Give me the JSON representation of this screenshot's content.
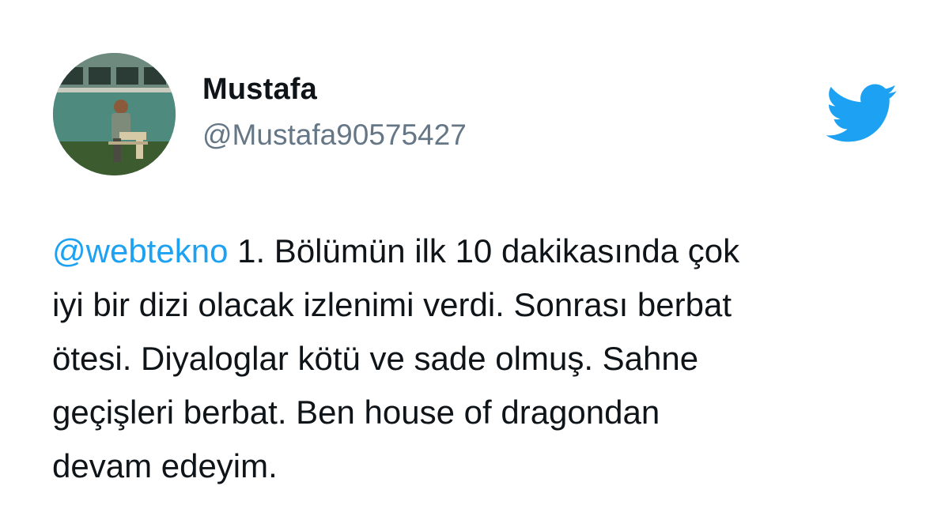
{
  "user": {
    "display_name": "Mustafa",
    "handle": "@Mustafa90575427",
    "avatar_icon": "profile-photo"
  },
  "logo": {
    "icon": "twitter-bird-icon",
    "color": "#1DA1F2"
  },
  "tweet": {
    "mention": "@webtekno",
    "lines": [
      " 1. Bölümün ilk 10 dakikasında çok",
      "iyi bir dizi olacak izlenimi verdi. Sonrası berbat",
      "ötesi. Diyaloglar kötü ve sade olmuş. Sahne",
      "geçişleri berbat. Ben house of dragondan",
      "devam edeyim."
    ]
  },
  "colors": {
    "text": "#0F1419",
    "handle": "#657786",
    "mention": "#1DA1F2",
    "background": "#FFFFFF"
  }
}
